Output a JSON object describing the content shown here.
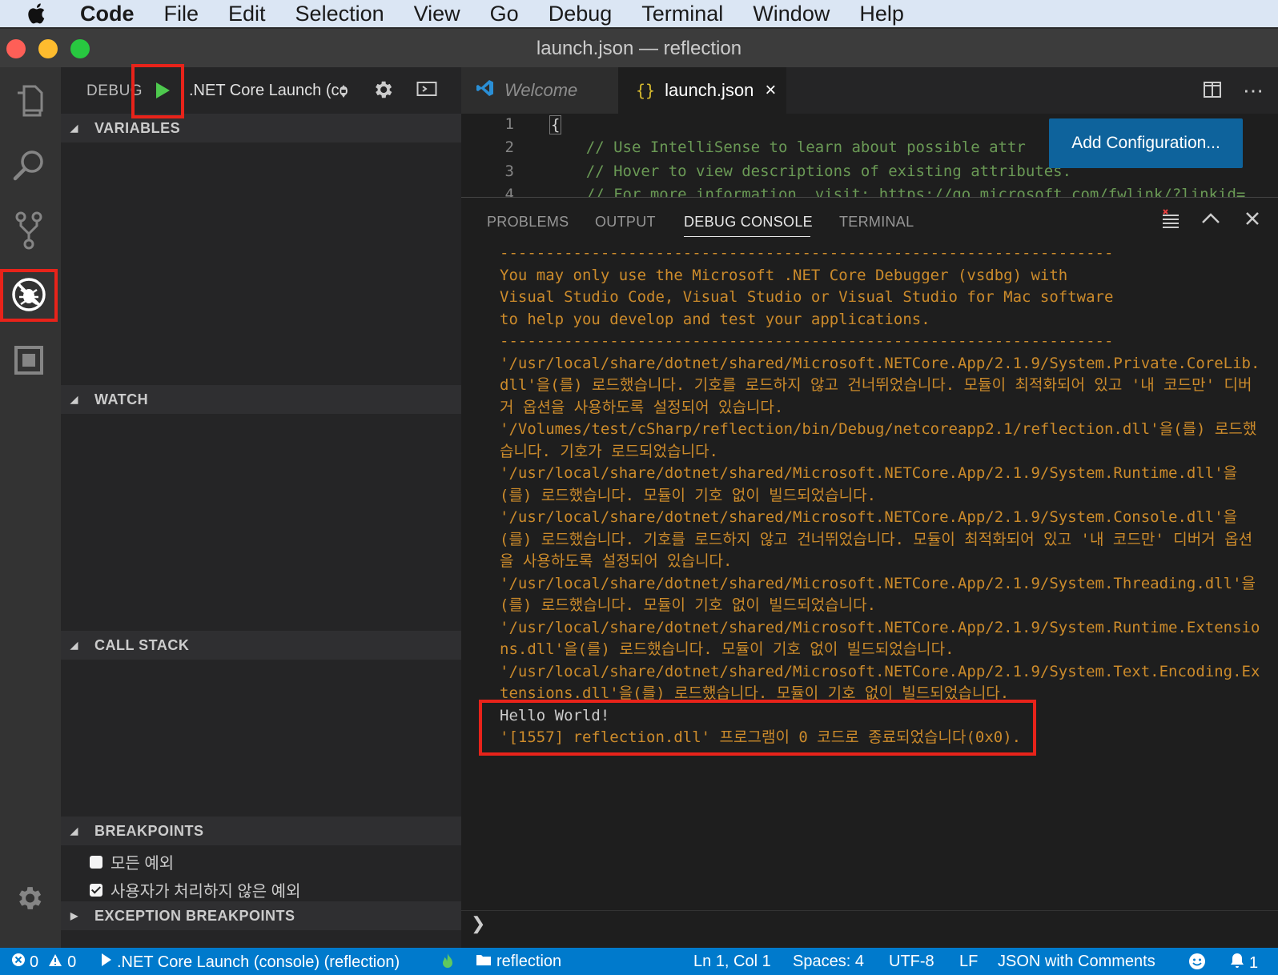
{
  "menubar": {
    "app": "Code",
    "items": [
      "File",
      "Edit",
      "Selection",
      "View",
      "Go",
      "Debug",
      "Terminal",
      "Window",
      "Help"
    ]
  },
  "window": {
    "title": "launch.json — reflection"
  },
  "activity_bar": {
    "items": [
      "explorer-icon",
      "search-icon",
      "source-control-icon",
      "debug-icon",
      "extensions-icon"
    ],
    "bottom": "manage-gear-icon"
  },
  "debug": {
    "label": "DEBUG",
    "config": ".NET Core Launch (co"
  },
  "sections": {
    "variables": "VARIABLES",
    "watch": "WATCH",
    "call_stack": "CALL STACK",
    "breakpoints": "BREAKPOINTS",
    "exception_breakpoints": "EXCEPTION BREAKPOINTS"
  },
  "breakpoints": [
    {
      "label": "모든 예외",
      "checked": false
    },
    {
      "label": "사용자가 처리하지 않은 예외",
      "checked": true
    }
  ],
  "tabs": [
    {
      "label": "Welcome",
      "active": false
    },
    {
      "label": "launch.json",
      "active": true,
      "close": "×"
    }
  ],
  "editor": {
    "lines": [
      {
        "num": "1",
        "text": "{"
      },
      {
        "num": "2",
        "text": "    // Use IntelliSense to learn about possible attr"
      },
      {
        "num": "3",
        "text": "    // Hover to view descriptions of existing attributes."
      },
      {
        "num": "4",
        "text": "    // For more information, visit: https://go.microsoft.com/fwlink/?linkid="
      }
    ],
    "add_config": "Add Configuration..."
  },
  "panel": {
    "tabs": [
      "PROBLEMS",
      "OUTPUT",
      "DEBUG CONSOLE",
      "TERMINAL"
    ],
    "active_tab": "DEBUG CONSOLE",
    "output": [
      "-------------------------------------------------------------------",
      "You may only use the Microsoft .NET Core Debugger (vsdbg) with",
      "Visual Studio Code, Visual Studio or Visual Studio for Mac software",
      "to help you develop and test your applications.",
      "-------------------------------------------------------------------",
      "'/usr/local/share/dotnet/shared/Microsoft.NETCore.App/2.1.9/System.Private.CoreLib.dll'을(를) 로드했습니다. 기호를 로드하지 않고 건너뛰었습니다. 모듈이 최적화되어 있고 '내 코드만' 디버거 옵션을 사용하도록 설정되어 있습니다.",
      "'/Volumes/test/cSharp/reflection/bin/Debug/netcoreapp2.1/reflection.dll'을(를) 로드했습니다. 기호가 로드되었습니다.",
      "'/usr/local/share/dotnet/shared/Microsoft.NETCore.App/2.1.9/System.Runtime.dll'을(를) 로드했습니다. 모듈이 기호 없이 빌드되었습니다.",
      "'/usr/local/share/dotnet/shared/Microsoft.NETCore.App/2.1.9/System.Console.dll'을(를) 로드했습니다. 기호를 로드하지 않고 건너뛰었습니다. 모듈이 최적화되어 있고 '내 코드만' 디버거 옵션을 사용하도록 설정되어 있습니다.",
      "'/usr/local/share/dotnet/shared/Microsoft.NETCore.App/2.1.9/System.Threading.dll'을(를) 로드했습니다. 모듈이 기호 없이 빌드되었습니다.",
      "'/usr/local/share/dotnet/shared/Microsoft.NETCore.App/2.1.9/System.Runtime.Extensions.dll'을(를) 로드했습니다. 모듈이 기호 없이 빌드되었습니다.",
      "'/usr/local/share/dotnet/shared/Microsoft.NETCore.App/2.1.9/System.Text.Encoding.Extensions.dll'을(를) 로드했습니다. 모듈이 기호 없이 빌드되었습니다.",
      "Hello World!",
      "'[1557] reflection.dll' 프로그램이 0 코드로 종료되었습니다(0x0)."
    ],
    "prompt": "❯"
  },
  "status": {
    "errors": "0",
    "warnings": "0",
    "launch": ".NET Core Launch (console) (reflection)",
    "folder": "reflection",
    "position": "Ln 1, Col 1",
    "spaces": "Spaces: 4",
    "encoding": "UTF-8",
    "eol": "LF",
    "language": "JSON with Comments",
    "notifications": "1"
  },
  "colors": {
    "accent": "#007acc",
    "highlight_red": "#e8231a",
    "console_text": "#cc8b2b"
  }
}
